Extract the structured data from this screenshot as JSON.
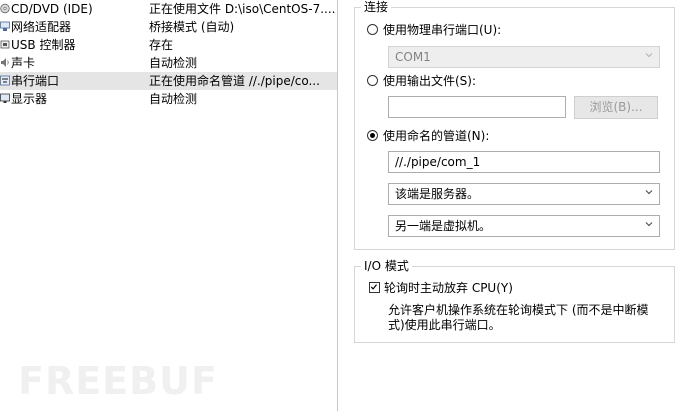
{
  "hardware_list": [
    {
      "name": "CD/DVD (IDE)",
      "summary": "正在使用文件 D:\\iso\\CentOS-7....",
      "icon": "cd-dvd-icon",
      "selected": false
    },
    {
      "name": "网络适配器",
      "summary": "桥接模式 (自动)",
      "icon": "network-adapter-icon",
      "selected": false
    },
    {
      "name": "USB 控制器",
      "summary": "存在",
      "icon": "usb-controller-icon",
      "selected": false
    },
    {
      "name": "声卡",
      "summary": "自动检测",
      "icon": "sound-card-icon",
      "selected": false
    },
    {
      "name": "串行端口",
      "summary": "正在使用命名管道 //./pipe/co...",
      "icon": "serial-port-icon",
      "selected": true
    },
    {
      "name": "显示器",
      "summary": "自动检测",
      "icon": "display-icon",
      "selected": false
    }
  ],
  "connection": {
    "legend": "连接",
    "physical_port_label": "使用物理串行端口(U):",
    "physical_port_value": "COM1",
    "output_file_label": "使用输出文件(S):",
    "output_file_value": "",
    "browse_label": "浏览(B)...",
    "named_pipe_label": "使用命名的管道(N):",
    "named_pipe_value": "//./pipe/com_1",
    "end_role_value": "该端是服务器。",
    "other_end_value": "另一端是虚拟机。",
    "selected_option": "named_pipe"
  },
  "io_mode": {
    "legend": "I/O 模式",
    "yield_cpu_label": "轮询时主动放弃 CPU(Y)",
    "yield_cpu_checked": true,
    "description_line1": "允许客户机操作系统在轮询模式下 (而不是中断模",
    "description_line2": "式)使用此串行端口。"
  },
  "watermark": "FREEBUF"
}
